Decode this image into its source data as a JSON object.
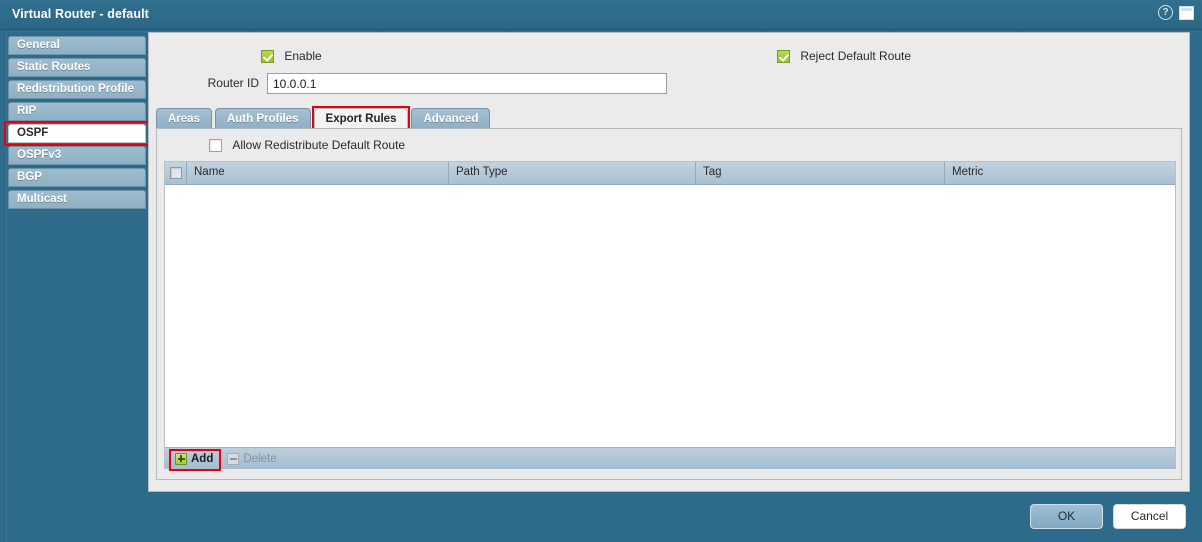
{
  "window": {
    "title": "Virtual Router - default",
    "help_icon": "help-circle-icon",
    "window_icon": "restore-window-icon"
  },
  "sidebar": {
    "items": [
      {
        "label": "General",
        "selected": false
      },
      {
        "label": "Static Routes",
        "selected": false
      },
      {
        "label": "Redistribution Profile",
        "selected": false
      },
      {
        "label": "RIP",
        "selected": false
      },
      {
        "label": "OSPF",
        "selected": true
      },
      {
        "label": "OSPFv3",
        "selected": false
      },
      {
        "label": "BGP",
        "selected": false
      },
      {
        "label": "Multicast",
        "selected": false
      }
    ],
    "highlighted_item": "OSPF"
  },
  "main": {
    "enable": {
      "label": "Enable",
      "checked": true
    },
    "reject_default_route": {
      "label": "Reject Default Route",
      "checked": true
    },
    "router_id": {
      "label": "Router ID",
      "value": "10.0.0.1"
    },
    "tabs": [
      {
        "label": "Areas",
        "selected": false
      },
      {
        "label": "Auth Profiles",
        "selected": false
      },
      {
        "label": "Export Rules",
        "selected": true
      },
      {
        "label": "Advanced",
        "selected": false
      }
    ],
    "allow_redistribute": {
      "label": "Allow Redistribute Default Route",
      "checked": false
    },
    "grid": {
      "columns": [
        "Name",
        "Path Type",
        "Tag",
        "Metric"
      ],
      "rows": [],
      "select_all_checked": false
    },
    "grid_actions": {
      "add": {
        "label": "Add",
        "enabled": true,
        "icon": "plus-icon"
      },
      "delete": {
        "label": "Delete",
        "enabled": false,
        "icon": "minus-icon"
      }
    }
  },
  "footer": {
    "ok_label": "OK",
    "cancel_label": "Cancel"
  },
  "colors": {
    "window_chrome": "#2e6b8a",
    "panel_bg": "#ebebeb",
    "grid_header": "#b1c6d6",
    "grid_footer": "#aec3d4",
    "highlight_red": "#e3000f",
    "check_green": "#9dc02e",
    "tab_inactive": "#95b4c8"
  }
}
